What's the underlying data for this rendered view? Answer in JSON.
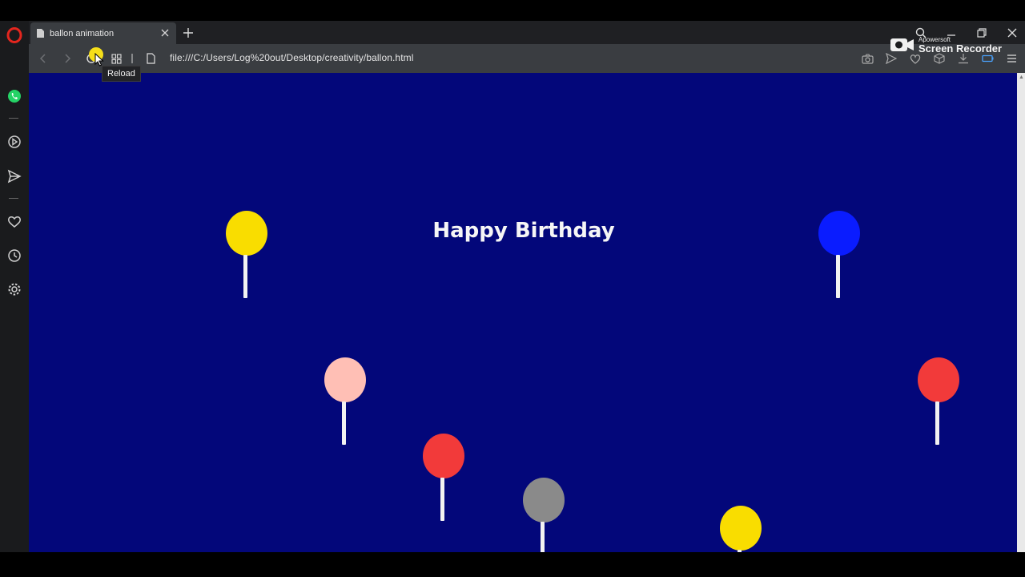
{
  "browser": {
    "tab": {
      "title": "ballon animation",
      "icon": "page-icon"
    },
    "address": "file:///C:/Users/Log%20out/Desktop/creativity/ballon.html",
    "tooltip": "Reload",
    "watermark": {
      "small": "Apowersoft",
      "big": "Screen Recorder"
    },
    "sidebar_icons": [
      "opera-logo-icon",
      "whatsapp-icon",
      "player-icon",
      "send-icon",
      "heart-icon",
      "history-icon",
      "settings-icon"
    ]
  },
  "page": {
    "headline": "Happy Birthday",
    "background": "#03077a",
    "balloon_colors": [
      "#f9dd00",
      "#0a1cff",
      "#ffbfb5",
      "#f23a3a",
      "#f23a3a",
      "#8a8a8a",
      "#f9dd00"
    ]
  }
}
